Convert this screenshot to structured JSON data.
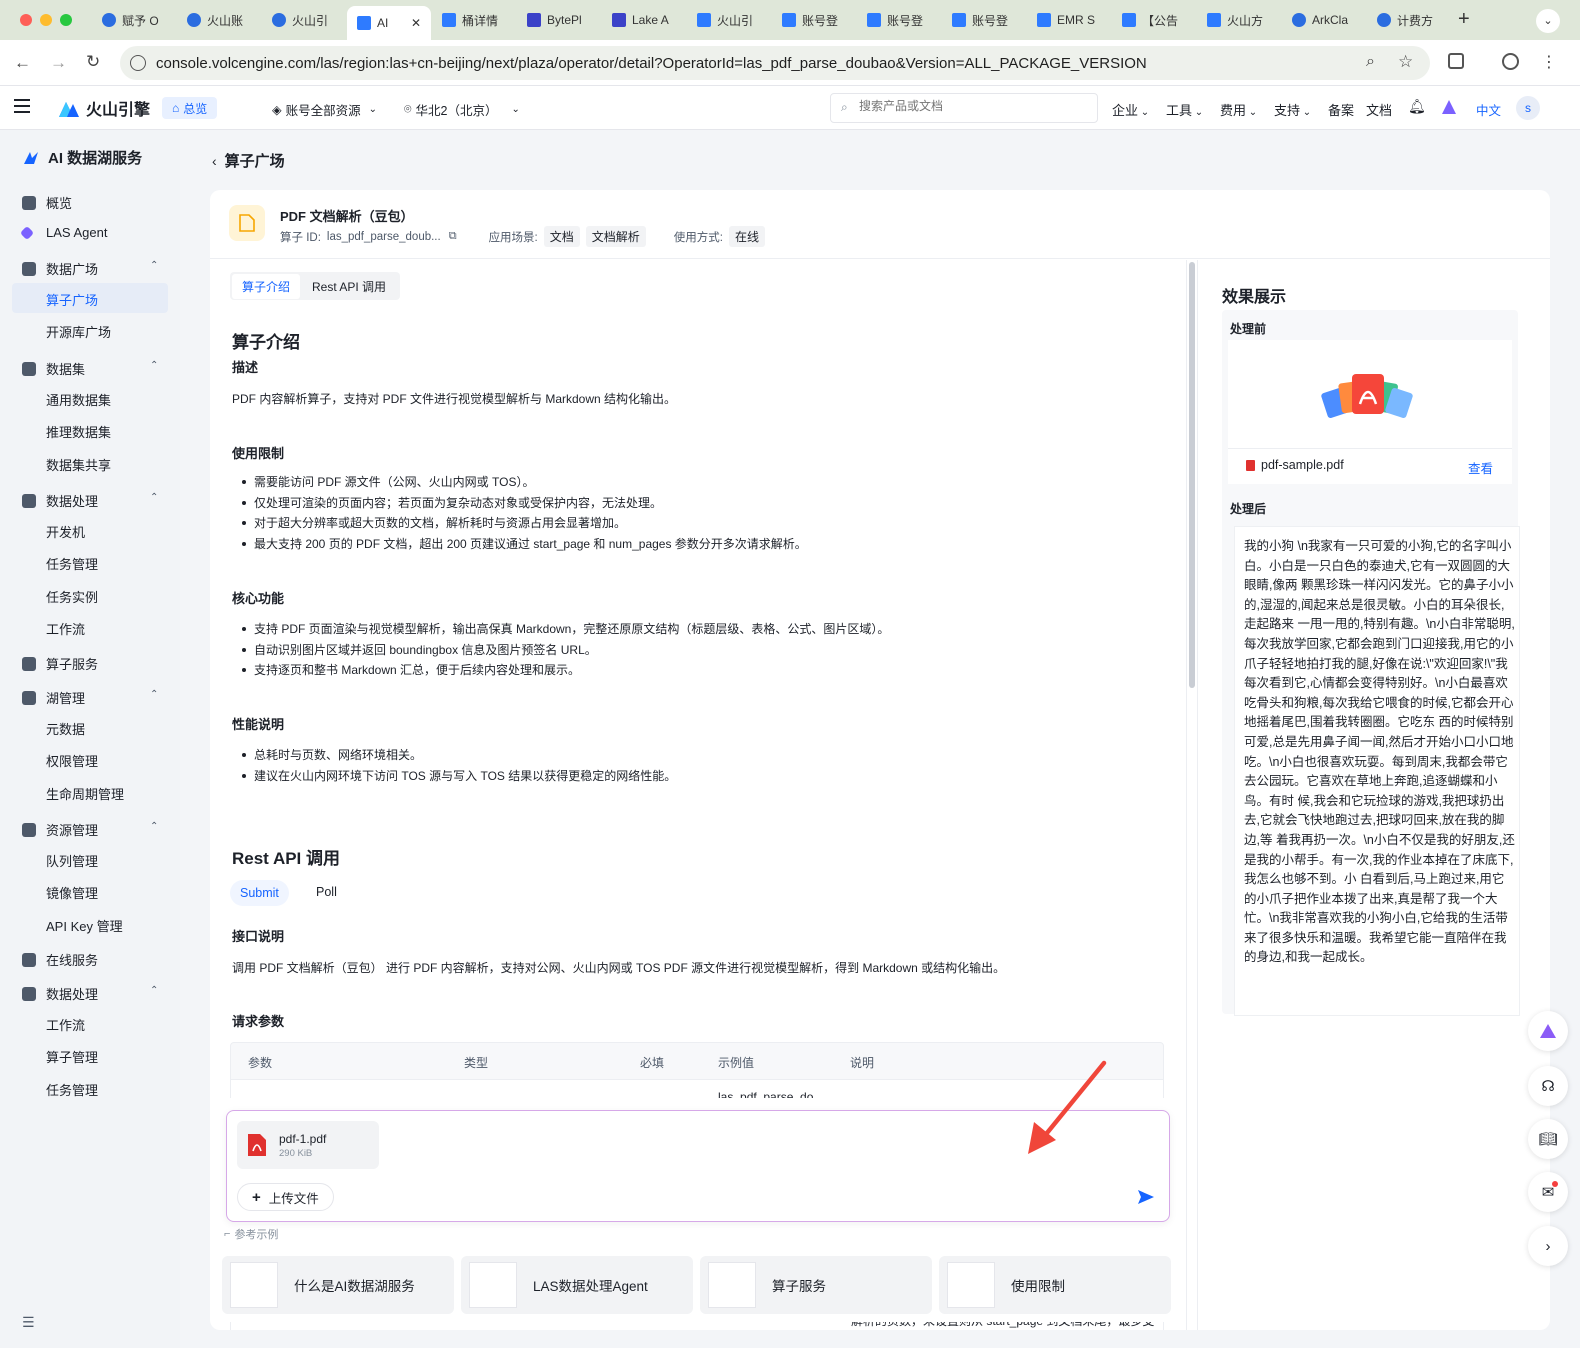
{
  "browser": {
    "tabs": [
      "赋予 O",
      "火山账",
      "火山引",
      "AI",
      "桶详情",
      "BytePl",
      "Lake A",
      "火山引",
      "账号登",
      "账号登",
      "账号登",
      "EMR S",
      "【公告",
      "火山方",
      "ArkCla",
      "计费方"
    ],
    "url": "console.volcengine.com/las/region:las+cn-beijing/next/plaza/operator/detail?OperatorId=las_pdf_parse_doubao&Version=ALL_PACKAGE_VERSION"
  },
  "topnav": {
    "brand": "火山引擎",
    "overview": "总览",
    "account": "账号全部资源",
    "region": "华北2（北京）",
    "search_placeholder": "搜索产品或文档",
    "menus": [
      "企业",
      "工具",
      "费用",
      "支持"
    ],
    "links": [
      "备案",
      "文档"
    ],
    "lang": "中文",
    "avatar": "s"
  },
  "sidebar": {
    "title": "AI 数据湖服务",
    "overview": "概览",
    "agent": "LAS Agent",
    "groups": [
      {
        "label": "数据广场",
        "items": [
          "算子广场",
          "开源库广场"
        ]
      },
      {
        "label": "数据集",
        "items": [
          "通用数据集",
          "推理数据集",
          "数据集共享"
        ]
      },
      {
        "label": "数据处理",
        "items": [
          "开发机",
          "任务管理",
          "任务实例",
          "工作流"
        ]
      },
      {
        "label": "算子服务",
        "items": []
      },
      {
        "label": "湖管理",
        "items": [
          "元数据",
          "权限管理",
          "生命周期管理"
        ]
      },
      {
        "label": "资源管理",
        "items": [
          "队列管理",
          "镜像管理",
          "API Key 管理"
        ]
      },
      {
        "label": "在线服务",
        "items": []
      },
      {
        "label": "数据处理",
        "items": [
          "工作流",
          "算子管理",
          "任务管理"
        ]
      }
    ],
    "active": "算子广场"
  },
  "breadcrumb": "算子广场",
  "operator": {
    "name": "PDF 文档解析（豆包）",
    "id_label": "算子 ID:",
    "id_value": "las_pdf_parse_doub...",
    "scene_label": "应用场景:",
    "scene_tags": [
      "文档",
      "文档解析"
    ],
    "usage_label": "使用方式:",
    "usage_tag": "在线"
  },
  "tabs": [
    "算子介绍",
    "Rest API 调用"
  ],
  "intro": {
    "heading": "算子介绍",
    "desc_h": "描述",
    "desc": "PDF 内容解析算子，支持对 PDF 文件进行视觉模型解析与 Markdown 结构化输出。",
    "limits_h": "使用限制",
    "limits": [
      "需要能访问 PDF 源文件（公网、火山内网或 TOS）。",
      "仅处理可渲染的页面内容；若页面为复杂动态对象或受保护内容，无法处理。",
      "对于超大分辨率或超大页数的文档，解析耗时与资源占用会显著增加。",
      "最大支持 200 页的 PDF 文档，超出 200 页建议通过 start_page 和 num_pages 参数分开多次请求解析。"
    ],
    "core_h": "核心功能",
    "core": [
      "支持 PDF 页面渲染与视觉模型解析，输出高保真 Markdown，完整还原原文结构（标题层级、表格、公式、图片区域）。",
      "自动识别图片区域并返回 boundingbox 信息及图片预签名 URL。",
      "支持逐页和整书 Markdown 汇总，便于后续内容处理和展示。"
    ],
    "perf_h": "性能说明",
    "perf": [
      "总耗时与页数、网络环境相关。",
      "建议在火山内网环境下访问 TOS 源与写入 TOS 结果以获得更稳定的网络性能。"
    ]
  },
  "api": {
    "heading": "Rest API 调用",
    "subtabs": [
      "Submit",
      "Poll"
    ],
    "iface_h": "接口说明",
    "iface": "调用 PDF 文档解析（豆包） 进行 PDF 内容解析，支持对公网、火山内网或 TOS PDF 源文件进行视觉模型解析，得到 Markdown 或结构化输出。",
    "params_h": "请求参数",
    "columns": [
      "参数",
      "类型",
      "必填",
      "示例值",
      "说明"
    ],
    "peek_row_example": "las_pdf_parse_do",
    "peek_bottom": "解析的页数，未设置则从 start_page 到文档末尾，最多支"
  },
  "effect": {
    "heading": "效果展示",
    "before": "处理前",
    "file": "pdf-sample.pdf",
    "view": "查看",
    "after": "处理后",
    "after_text": "我的小狗 \\n我家有一只可爱的小狗,它的名字叫小白。小白是一只白色的泰迪犬,它有一双圆圆的大眼睛,像两 颗黑珍珠一样闪闪发光。它的鼻子小小的,湿湿的,闻起来总是很灵敏。小白的耳朵很长,走起路来 一甩一甩的,特别有趣。\\n小白非常聪明,每次我放学回家,它都会跑到门口迎接我,用它的小爪子轻轻地拍打我的腿,好像在说:\\\"欢迎回家!\\\"我每次看到它,心情都会变得特别好。\\n小白最喜欢吃骨头和狗粮,每次我给它喂食的时候,它都会开心地摇着尾巴,围着我转圈圈。它吃东 西的时候特别可爱,总是先用鼻子闻一闻,然后才开始小口小口地吃。\\n小白也很喜欢玩耍。每到周末,我都会带它去公园玩。它喜欢在草地上奔跑,追逐蝴蝶和小鸟。有时 候,我会和它玩捡球的游戏,我把球扔出去,它就会飞快地跑过去,把球叼回来,放在我的脚边,等 着我再扔一次。\\n小白不仅是我的好朋友,还是我的小帮手。有一次,我的作业本掉在了床底下,我怎么也够不到。小 白看到后,马上跑过来,用它的小爪子把作业本拨了出来,真是帮了我一个大忙。\\n我非常喜欢我的小狗小白,它给我的生活带来了很多快乐和温暖。我希望它能一直陪伴在我的身边,和我一起成长。"
  },
  "composer": {
    "file_name": "pdf-1.pdf",
    "file_size": "290 KiB",
    "upload": "上传文件",
    "examples_label": "参考示例",
    "examples": [
      "什么是AI数据湖服务",
      "LAS数据处理Agent",
      "算子服务",
      "使用限制"
    ]
  },
  "colors": {
    "accent": "#1664ff",
    "pdf_red": "#e0312e",
    "arrow": "#f0463a"
  }
}
